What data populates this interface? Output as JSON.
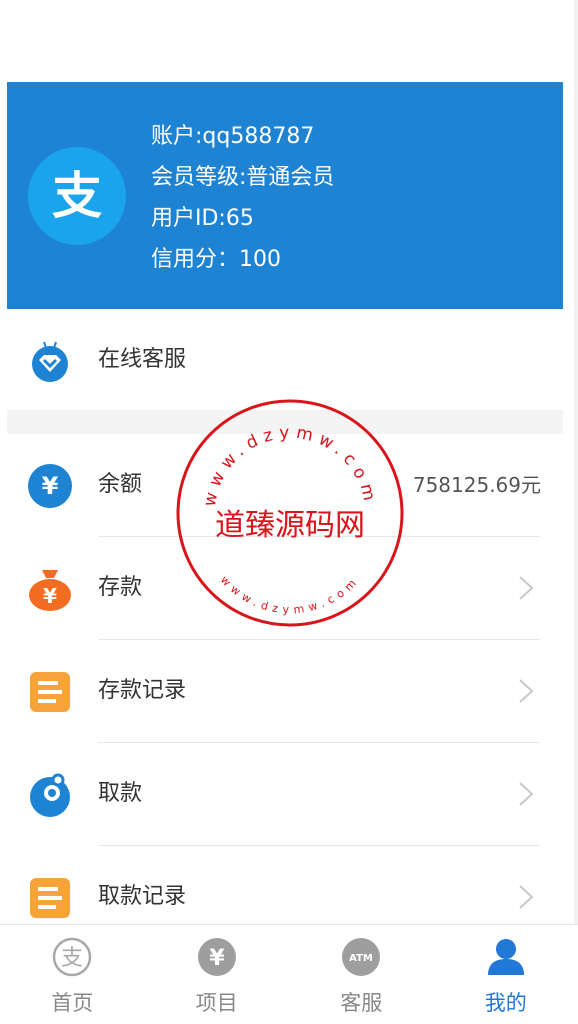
{
  "profile": {
    "avatar_char": "支",
    "account": "账户:qq588787",
    "level": "会员等级:普通会员",
    "user_id": "用户ID:65",
    "credit": "信用分：100"
  },
  "menu": {
    "service": "在线客服",
    "balance_label": "余额",
    "balance_value": "758125.69元",
    "deposit": "存款",
    "deposit_record": "存款记录",
    "withdraw": "取款",
    "withdraw_record": "取款记录"
  },
  "stamp": {
    "top_text": "www.dzymw.com",
    "center_text": "道臻源码网",
    "bottom_text": "www.dzymw.com"
  },
  "tabbar": {
    "home": "首页",
    "projects": "项目",
    "service": "客服",
    "mine": "我的",
    "home_glyph": "支",
    "projects_glyph": "¥",
    "service_glyph": "ATM"
  },
  "colors": {
    "header_blue": "#1e83d3",
    "active_tab": "#2178d6",
    "stamp_red": "#d9141b"
  },
  "icons": {
    "service": "diamond-chat-icon",
    "balance": "yen-circle-icon",
    "deposit": "money-bag-icon",
    "deposit_record": "document-icon",
    "withdraw": "swirl-icon",
    "withdraw_record": "document-icon"
  }
}
